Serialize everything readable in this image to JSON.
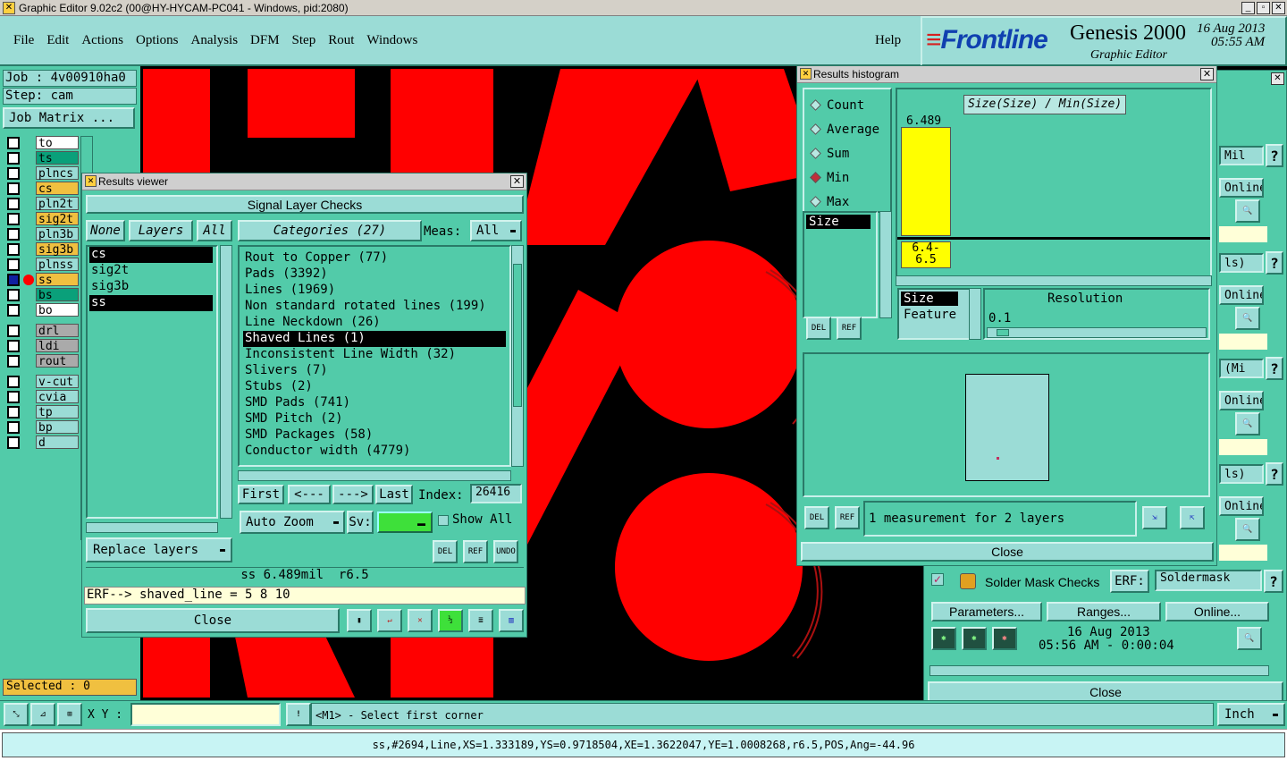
{
  "window": {
    "title": "Graphic Editor 9.02c2 (00@HY-HYCAM-PC041 - Windows, pid:2080)"
  },
  "menu": [
    "File",
    "Edit",
    "Actions",
    "Options",
    "Analysis",
    "DFM",
    "Step",
    "Rout",
    "Windows"
  ],
  "help": "Help",
  "brand": {
    "logo": "Frontline",
    "product": "Genesis 2000",
    "subtitle": "Graphic Editor",
    "date": "16 Aug 2013",
    "time": "05:55 AM"
  },
  "job": {
    "job": "Job : 4v00910ha0",
    "step": "Step: cam",
    "matrix_btn": "Job Matrix ..."
  },
  "layers": [
    {
      "name": "to",
      "color": "#ffffff"
    },
    {
      "name": "ts",
      "color": "#0aa07a"
    },
    {
      "name": "plncs",
      "color": "#9bdcd6"
    },
    {
      "name": "cs",
      "color": "#f0c040"
    },
    {
      "name": "pln2t",
      "color": "#9bdcd6"
    },
    {
      "name": "sig2t",
      "color": "#f0c040"
    },
    {
      "name": "pln3b",
      "color": "#9bdcd6"
    },
    {
      "name": "sig3b",
      "color": "#f0c040"
    },
    {
      "name": "plnss",
      "color": "#9bdcd6"
    },
    {
      "name": "ss",
      "color": "#f0c040"
    },
    {
      "name": "bs",
      "color": "#0aa07a"
    },
    {
      "name": "bo",
      "color": "#ffffff"
    },
    {
      "name": "drl",
      "color": "#aaaaaa"
    },
    {
      "name": "ldi",
      "color": "#aaaaaa"
    },
    {
      "name": "rout",
      "color": "#aaaaaa"
    },
    {
      "name": "v-cut",
      "color": "#9bdcd6"
    },
    {
      "name": "cvia",
      "color": "#9bdcd6"
    },
    {
      "name": "tp",
      "color": "#9bdcd6"
    },
    {
      "name": "bp",
      "color": "#9bdcd6"
    },
    {
      "name": "d",
      "color": "#9bdcd6"
    }
  ],
  "selected": "Selected : 0",
  "results_viewer": {
    "title": "Results viewer",
    "heading": "Signal Layer Checks",
    "none": "None",
    "layers_lbl": "Layers",
    "all": "All",
    "categories_btn": "Categories (27)",
    "meas_lbl": "Meas:",
    "meas_val": "All",
    "layer_list": [
      "cs",
      "sig2t",
      "sig3b",
      "ss"
    ],
    "categories": [
      "Rout to Copper (77)",
      "Pads (3392)",
      "Lines (1969)",
      "Non standard rotated lines (199)",
      "Line Neckdown (26)",
      "Shaved Lines (1)",
      "Inconsistent Line Width (32)",
      "Slivers (7)",
      "Stubs (2)",
      "SMD Pads (741)",
      "SMD Pitch (2)",
      "SMD Packages (58)",
      "Conductor width (4779)"
    ],
    "first": "First",
    "prev": "<---",
    "next": "--->",
    "last": "Last",
    "index_lbl": "Index:",
    "index_val": "26416",
    "autozoom": "Auto Zoom",
    "sv": "Sv:",
    "show_all": "Show All",
    "replace": "Replace layers",
    "del": "DEL",
    "ref": "REF",
    "undo": "UNDO",
    "status": "ss 6.489mil  r6.5",
    "erf": "ERF--> shaved_line = 5 8 10",
    "close": "Close"
  },
  "histogram": {
    "title": "Results histogram",
    "modes": [
      "Count",
      "Average",
      "Sum",
      "Min",
      "Max"
    ],
    "selected_mode": "Min",
    "formula": "Size(Size) / Min(Size)",
    "bar_value_label": "6.489",
    "bin_label": "6.4-\n6.5",
    "list1": "Size",
    "res_title": "Resolution",
    "res_items": [
      "Size",
      "Feature"
    ],
    "res_value": "0.1",
    "del": "DEL",
    "ref": "REF",
    "summary": "1 measurement for 2 layers",
    "close": "Close"
  },
  "right_panel": {
    "partial": [
      "Mil",
      "Online...",
      "ls)",
      "Online...",
      "(Mi",
      "Online...",
      "ls)",
      "Online..."
    ],
    "solder_title": "Solder Mask Checks",
    "erf_lbl": "ERF:",
    "erf_val": "Soldermask",
    "params": "Parameters...",
    "ranges": "Ranges...",
    "online": "Online...",
    "date": "16 Aug 2013",
    "time": "05:56 AM - 0:00:04",
    "close": "Close"
  },
  "bottom": {
    "xy_lbl": "X Y :",
    "xy_val": "",
    "prompt": "<M1> - Select first corner",
    "units": "Inch",
    "status": "ss,#2694,Line,XS=1.333189,YS=0.9718504,XE=1.3622047,YE=1.0008268,r6.5,POS,Ang=-44.96"
  },
  "colors": {
    "teal": "#52cba9",
    "light": "#9bdcd6",
    "copper": "#ff0000",
    "highlight": "#ffff00"
  }
}
